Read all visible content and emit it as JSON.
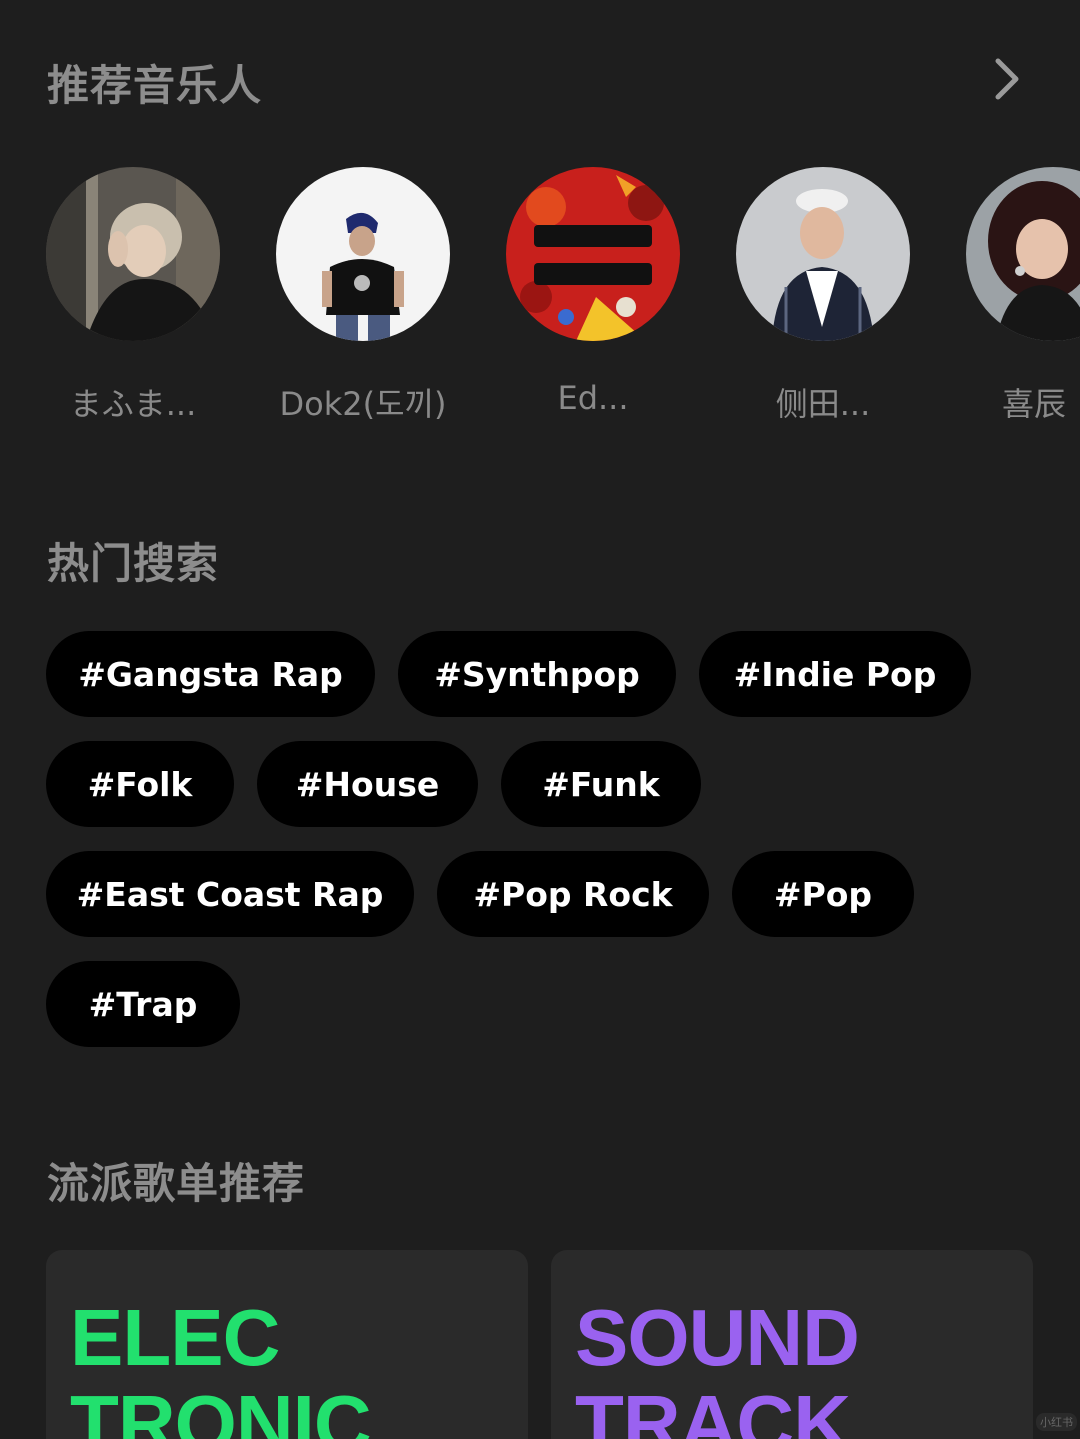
{
  "sections": {
    "artists_title": "推荐音乐人",
    "hot_title": "热门搜索",
    "genre_title": "流派歌单推荐"
  },
  "artists": [
    {
      "name": "まふま..."
    },
    {
      "name": "Dok2(도끼)"
    },
    {
      "name": "Ed..."
    },
    {
      "name": "侧田..."
    },
    {
      "name": "喜辰"
    }
  ],
  "tags": [
    "#Gangsta Rap",
    "#Synthpop",
    "#Indie Pop",
    "#Folk",
    "#House",
    "#Funk",
    "#East Coast Rap",
    "#Pop Rock",
    "#Pop",
    "#Trap"
  ],
  "genre_cards": [
    {
      "line1": "ELEC",
      "line2": "TRONIC",
      "color": "#22e06e"
    },
    {
      "line1": "SOUND",
      "line2": "TRACK",
      "color": "#9a62f0"
    }
  ],
  "icons": {
    "more": "chevron-right-icon"
  },
  "watermark": "小红书"
}
